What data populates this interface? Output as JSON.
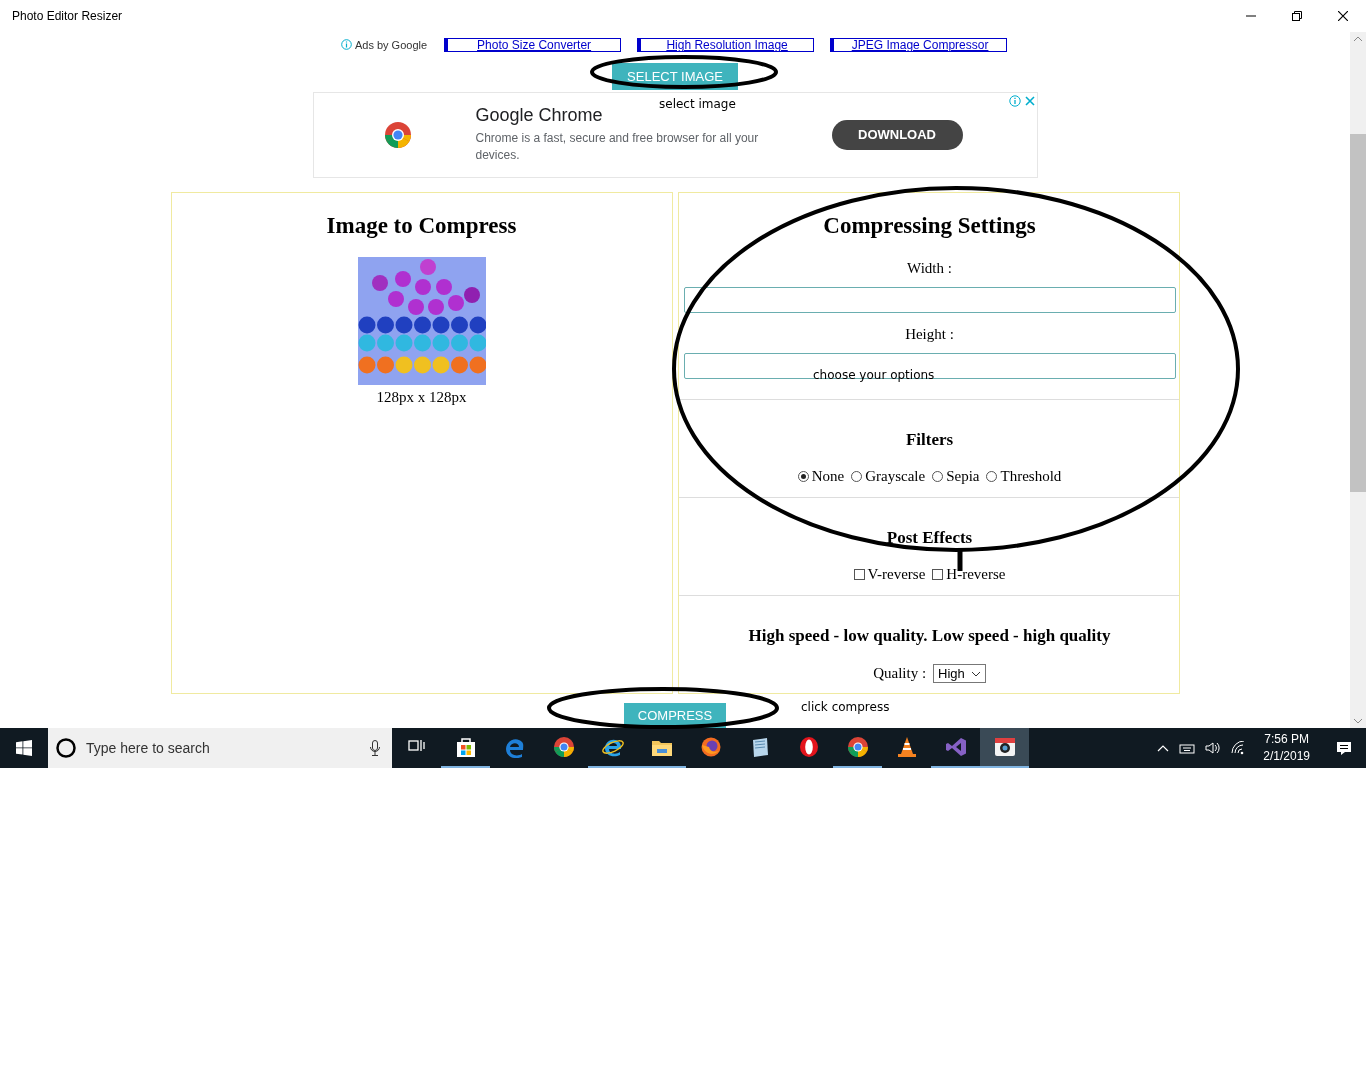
{
  "window": {
    "title": "Photo Editor Resizer"
  },
  "ads_bar": {
    "label": "Ads by Google",
    "links": [
      "Photo Size Converter",
      "High Resolution Image",
      "JPEG Image Compressor"
    ]
  },
  "select_button": "SELECT IMAGE",
  "ad": {
    "title": "Google Chrome",
    "text": "Chrome is a fast, secure and free browser for all your devices.",
    "button": "DOWNLOAD"
  },
  "image_panel": {
    "heading": "Image to Compress",
    "caption": "128px x 128px"
  },
  "settings": {
    "heading": "Compressing Settings",
    "width_label": "Width :",
    "height_label": "Height :"
  },
  "filters": {
    "heading": "Filters",
    "options": [
      {
        "label": "None",
        "selected": true
      },
      {
        "label": "Grayscale",
        "selected": false
      },
      {
        "label": "Sepia",
        "selected": false
      },
      {
        "label": "Threshold",
        "selected": false
      }
    ]
  },
  "post_effects": {
    "heading": "Post Effects",
    "options": [
      {
        "label": "V-reverse",
        "checked": false
      },
      {
        "label": "H-reverse",
        "checked": false
      }
    ]
  },
  "quality": {
    "heading": "High speed - low quality. Low speed - high quality",
    "label": "Quality :",
    "value": "High"
  },
  "compress_button": "COMPRESS",
  "notes": [
    {
      "kind": "select",
      "text": "select image"
    },
    {
      "kind": "options",
      "text": "choose your options"
    },
    {
      "kind": "compress",
      "text": "click compress"
    }
  ],
  "taskbar": {
    "search_placeholder": "Type here to search",
    "apps": [
      {
        "kind": "taskview",
        "running": false,
        "selected": false
      },
      {
        "kind": "store",
        "running": true,
        "selected": false
      },
      {
        "kind": "edge",
        "running": false,
        "selected": false
      },
      {
        "kind": "chrome",
        "running": false,
        "selected": false
      },
      {
        "kind": "ie",
        "running": true,
        "selected": false
      },
      {
        "kind": "files",
        "running": true,
        "selected": false
      },
      {
        "kind": "firefox",
        "running": false,
        "selected": false
      },
      {
        "kind": "notes",
        "running": false,
        "selected": false
      },
      {
        "kind": "opera",
        "running": false,
        "selected": false
      },
      {
        "kind": "chrome",
        "running": true,
        "selected": false
      },
      {
        "kind": "vlc",
        "running": false,
        "selected": false
      },
      {
        "kind": "vs",
        "running": true,
        "selected": false
      },
      {
        "kind": "camera",
        "running": true,
        "selected": true
      }
    ],
    "time": "7:56 PM",
    "date": "2/1/2019"
  }
}
